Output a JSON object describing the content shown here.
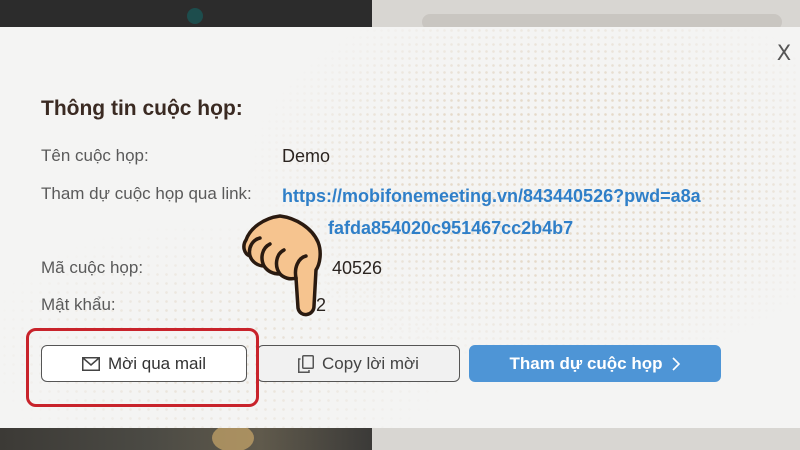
{
  "modal": {
    "close_label": "X",
    "title": "Thông tin cuộc họp:",
    "fields": {
      "name_label": "Tên cuộc họp:",
      "name_value": "Demo",
      "link_label": "Tham dự cuộc họp qua link:",
      "link_line1": "https://mobifonemeeting.vn/843440526?pwd=a8a",
      "link_line2": "fafda854020c951467cc2b4b7",
      "code_label": "Mã cuộc họp:",
      "code_value": "40526",
      "password_label": "Mật khẩu:",
      "password_value": "92"
    },
    "buttons": {
      "mail_label": "Mời qua mail",
      "copy_label": "Copy lời mời",
      "join_label": "Tham dự cuộc họp",
      "join_arrow": ">"
    }
  },
  "icons": {
    "mail": "envelope-icon",
    "copy": "copy-icon",
    "hand": "pointing-hand-icon"
  },
  "colors": {
    "accent_blue": "#4e95d6",
    "link_blue": "#2f7fc8",
    "highlight_red": "#c8232b"
  }
}
